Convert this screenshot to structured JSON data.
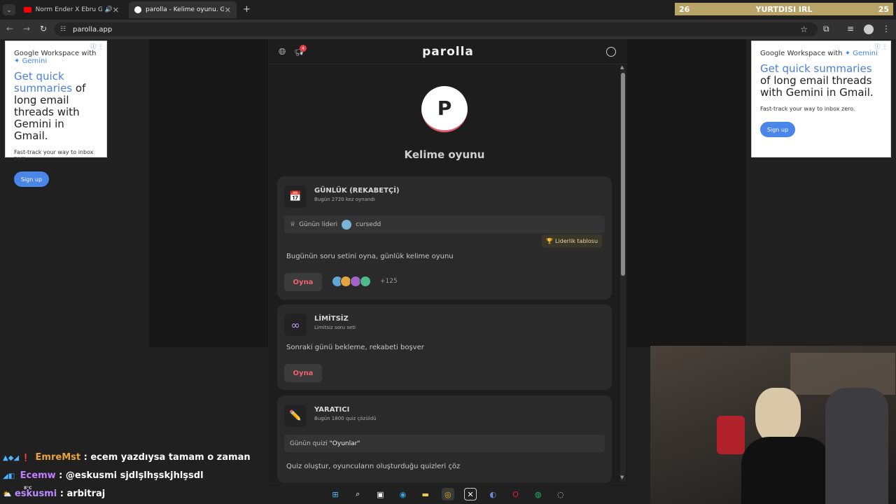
{
  "tabs": [
    {
      "title": "Norm Ender X Ebru Gündeş",
      "icon": "youtube-icon"
    },
    {
      "title": "parolla - Kelime oyunu. Günlük",
      "icon": "parolla-icon"
    }
  ],
  "stream_overlay": {
    "left": "26",
    "center": "YURTDISI IRL",
    "right": "25"
  },
  "address_bar": {
    "url": "parolla.app"
  },
  "ad": {
    "workspace": "Google Workspace with",
    "gemini": "Gemini",
    "headline_blue": "Get quick summaries",
    "headline_rest": " of long email threads with Gemini in ",
    "gmail": "Gmail.",
    "sub": "Fast-track your way to inbox zero.",
    "button": "Sign up"
  },
  "app": {
    "logo": "parolla",
    "notification_count": "4",
    "avatar_letter": "P",
    "page_title": "Kelime oyunu",
    "cards": {
      "daily": {
        "title": "GÜNLÜK (REKABETÇİ)",
        "subtitle": "Bugün 2720 kez oynandı",
        "leader_label": "Günün lideri",
        "leader_name": "cursedd",
        "leaderboard_button": "Liderlik tablosu",
        "description": "Bugünün soru setini oyna, günlük kelime oyunu",
        "play": "Oyna",
        "players_more": "+125"
      },
      "unlimited": {
        "title": "LİMİTSİZ",
        "subtitle": "Limitsiz soru seti",
        "description": "Sonraki günü bekleme, rekabeti boşver",
        "play": "Oyna"
      },
      "creator": {
        "title": "YARATICI",
        "subtitle": "Bugün 1800 quiz çözüldü",
        "quiz_label": "Günün quizi",
        "quiz_name": "\"Oyunlar\"",
        "description": "Quiz oluştur, oyuncuların oluşturduğu quizleri çöz"
      }
    }
  },
  "chat": [
    {
      "user": "EmreMst",
      "message": ": ecem yazdıysa tamam o zaman",
      "color": "#e8a33a"
    },
    {
      "user": "Ecemw",
      "message": ": @eskusmi sjdlşlhşskjhlşsdl",
      "color": "#c77dff"
    },
    {
      "user": "eskusmi",
      "message": ": arbitraj",
      "color": "#b88cff"
    }
  ],
  "weather": "8°C",
  "colors": {
    "accent_red": "#f06273",
    "ad_blue": "#4a86e8",
    "overlay_gold": "#b9a468"
  }
}
